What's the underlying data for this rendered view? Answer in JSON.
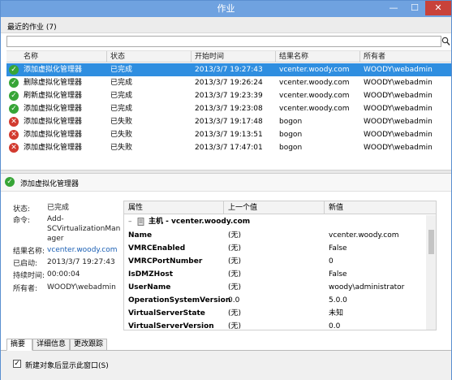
{
  "window": {
    "title": "作业",
    "minimize": "—",
    "maximize": "☐",
    "close": "✕"
  },
  "recent": {
    "label": "最近的作业 (7)"
  },
  "search": {
    "placeholder": "",
    "icon": "search-icon"
  },
  "jobs": {
    "columns": [
      "名称",
      "状态",
      "开始时间",
      "结果名称",
      "所有者"
    ],
    "rows": [
      {
        "status_icon": "ok",
        "name": "添加虚拟化管理器",
        "status": "已完成",
        "start": "2013/3/7 19:27:43",
        "result": "vcenter.woody.com",
        "owner": "WOODY\\webadmin",
        "selected": true
      },
      {
        "status_icon": "ok",
        "name": "删除虚拟化管理器",
        "status": "已完成",
        "start": "2013/3/7 19:26:24",
        "result": "vcenter.woody.com",
        "owner": "WOODY\\webadmin",
        "selected": false
      },
      {
        "status_icon": "ok",
        "name": "刷新虚拟化管理器",
        "status": "已完成",
        "start": "2013/3/7 19:23:39",
        "result": "vcenter.woody.com",
        "owner": "WOODY\\webadmin",
        "selected": false
      },
      {
        "status_icon": "ok",
        "name": "添加虚拟化管理器",
        "status": "已完成",
        "start": "2013/3/7 19:23:08",
        "result": "vcenter.woody.com",
        "owner": "WOODY\\webadmin",
        "selected": false
      },
      {
        "status_icon": "fail",
        "name": "添加虚拟化管理器",
        "status": "已失败",
        "start": "2013/3/7 19:17:48",
        "result": "bogon",
        "owner": "WOODY\\webadmin",
        "selected": false
      },
      {
        "status_icon": "fail",
        "name": "添加虚拟化管理器",
        "status": "已失败",
        "start": "2013/3/7 19:13:51",
        "result": "bogon",
        "owner": "WOODY\\webadmin",
        "selected": false
      },
      {
        "status_icon": "fail",
        "name": "添加虚拟化管理器",
        "status": "已失败",
        "start": "2013/3/7 17:47:01",
        "result": "bogon",
        "owner": "WOODY\\webadmin",
        "selected": false
      }
    ]
  },
  "detail": {
    "title": "添加虚拟化管理器",
    "fields": [
      {
        "label": "状态:",
        "value": "已完成"
      },
      {
        "label": "命令:",
        "value": "Add-\nSCVirtualizationMan\nager"
      },
      {
        "label": "结果名称:",
        "value": "vcenter.woody.com"
      },
      {
        "label": "已启动:",
        "value": "2013/3/7 19:27:43"
      },
      {
        "label": "持续时间:",
        "value": "00:00:04"
      },
      {
        "label": "所有者:",
        "value": "WOODY\\webadmin"
      }
    ],
    "props": {
      "columns": [
        "属性",
        "上一个值",
        "新值"
      ],
      "host_label": "主机 - vcenter.woody.com",
      "rows": [
        {
          "name": "Name",
          "old": "(无)",
          "new": "vcenter.woody.com"
        },
        {
          "name": "VMRCEnabled",
          "old": "(无)",
          "new": "False"
        },
        {
          "name": "VMRCPortNumber",
          "old": "(无)",
          "new": "0"
        },
        {
          "name": "IsDMZHost",
          "old": "(无)",
          "new": "False"
        },
        {
          "name": "UserName",
          "old": "(无)",
          "new": "woody\\administrator"
        },
        {
          "name": "OperationSystemVersion",
          "old": "0.0",
          "new": "5.0.0"
        },
        {
          "name": "VirtualServerState",
          "old": "(无)",
          "new": "未知"
        },
        {
          "name": "VirtualServerVersion",
          "old": "(无)",
          "new": "0.0"
        }
      ]
    }
  },
  "tabs": [
    "摘要",
    "详细信息",
    "更改跟踪"
  ],
  "footer": {
    "checkbox_label": "新建对象后显示此窗口(S)",
    "checked": true,
    "check_glyph": "✓"
  },
  "colors": {
    "titlebar": "#6fa2e0",
    "selection": "#2f8ee0",
    "ok": "#37a537",
    "fail": "#d23a2f"
  }
}
